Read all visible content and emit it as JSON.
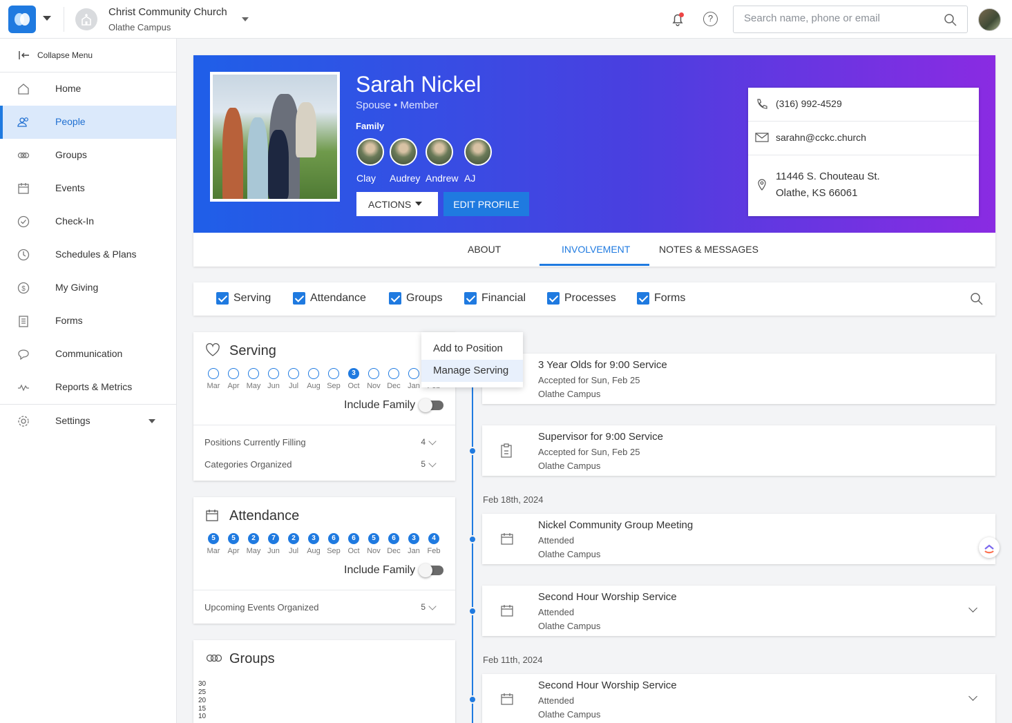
{
  "topbar": {
    "church_name": "Christ Community Church",
    "campus": "Olathe Campus",
    "search_placeholder": "Search name, phone or email"
  },
  "sidebar": {
    "collapse_label": "Collapse Menu",
    "items": [
      {
        "label": "Home",
        "icon": "home-icon"
      },
      {
        "label": "People",
        "icon": "people-icon",
        "active": true
      },
      {
        "label": "Groups",
        "icon": "groups-icon"
      },
      {
        "label": "Events",
        "icon": "calendar-icon"
      },
      {
        "label": "Check-In",
        "icon": "check-circle-icon"
      },
      {
        "label": "Schedules & Plans",
        "icon": "clock-icon"
      },
      {
        "label": "My Giving",
        "icon": "dollar-icon"
      },
      {
        "label": "Forms",
        "icon": "form-icon"
      },
      {
        "label": "Communication",
        "icon": "chat-icon"
      },
      {
        "label": "Reports & Metrics",
        "icon": "pulse-icon"
      },
      {
        "label": "Settings",
        "icon": "gear-icon"
      }
    ]
  },
  "profile": {
    "name": "Sarah Nickel",
    "role": "Spouse • Member",
    "family_label": "Family",
    "family": [
      "Clay",
      "Audrey",
      "Andrew",
      "AJ"
    ],
    "actions_label": "ACTIONS",
    "edit_label": "EDIT PROFILE",
    "phone": "(316) 992-4529",
    "email": "sarahn@cckc.church",
    "address_line1": "11446 S. Chouteau St.",
    "address_line2": "Olathe, KS 66061"
  },
  "tabs": [
    "ABOUT",
    "INVOLVEMENT",
    "NOTES & MESSAGES"
  ],
  "active_tab": "INVOLVEMENT",
  "filters": [
    "Serving",
    "Attendance",
    "Groups",
    "Financial",
    "Processes",
    "Forms"
  ],
  "serving": {
    "title": "Serving",
    "months": [
      "Mar",
      "Apr",
      "May",
      "Jun",
      "Jul",
      "Aug",
      "Sep",
      "Oct",
      "Nov",
      "Dec",
      "Jan",
      "Feb"
    ],
    "values": [
      "",
      "",
      "",
      "",
      "",
      "",
      "",
      "3",
      "",
      "",
      "",
      ""
    ],
    "include_family": "Include Family",
    "positions_label": "Positions Currently Filling",
    "positions_count": "4",
    "categories_label": "Categories Organized",
    "categories_count": "5"
  },
  "attendance": {
    "title": "Attendance",
    "months": [
      "Mar",
      "Apr",
      "May",
      "Jun",
      "Jul",
      "Aug",
      "Sep",
      "Oct",
      "Nov",
      "Dec",
      "Jan",
      "Feb"
    ],
    "values": [
      "5",
      "5",
      "2",
      "7",
      "2",
      "3",
      "6",
      "6",
      "5",
      "6",
      "3",
      "4"
    ],
    "include_family": "Include Family",
    "upcoming_label": "Upcoming Events Organized",
    "upcoming_count": "5"
  },
  "groups_card": {
    "title": "Groups",
    "y_ticks": [
      "30",
      "25",
      "20",
      "15",
      "10"
    ]
  },
  "dropdown": {
    "items": [
      "Add to Position",
      "Manage Serving"
    ]
  },
  "timeline": {
    "dates": [
      "Feb 18th, 2024",
      "Feb 11th, 2024"
    ],
    "items": [
      {
        "title": "3 Year Olds for 9:00 Service",
        "status": "Accepted for Sun, Feb 25",
        "campus": "Olathe Campus"
      },
      {
        "title": "Supervisor for 9:00 Service",
        "status": "Accepted for Sun, Feb 25",
        "campus": "Olathe Campus"
      },
      {
        "title": "Nickel Community Group Meeting",
        "status": "Attended",
        "campus": "Olathe Campus"
      },
      {
        "title": "Second Hour Worship Service",
        "status": "Attended",
        "campus": "Olathe Campus"
      },
      {
        "title": "Second Hour Worship Service",
        "status": "Attended",
        "campus": "Olathe Campus"
      }
    ]
  },
  "colors": {
    "accent": "#1f7ae0",
    "hero_start": "#1f5fe8",
    "hero_end": "#8a2be2"
  }
}
